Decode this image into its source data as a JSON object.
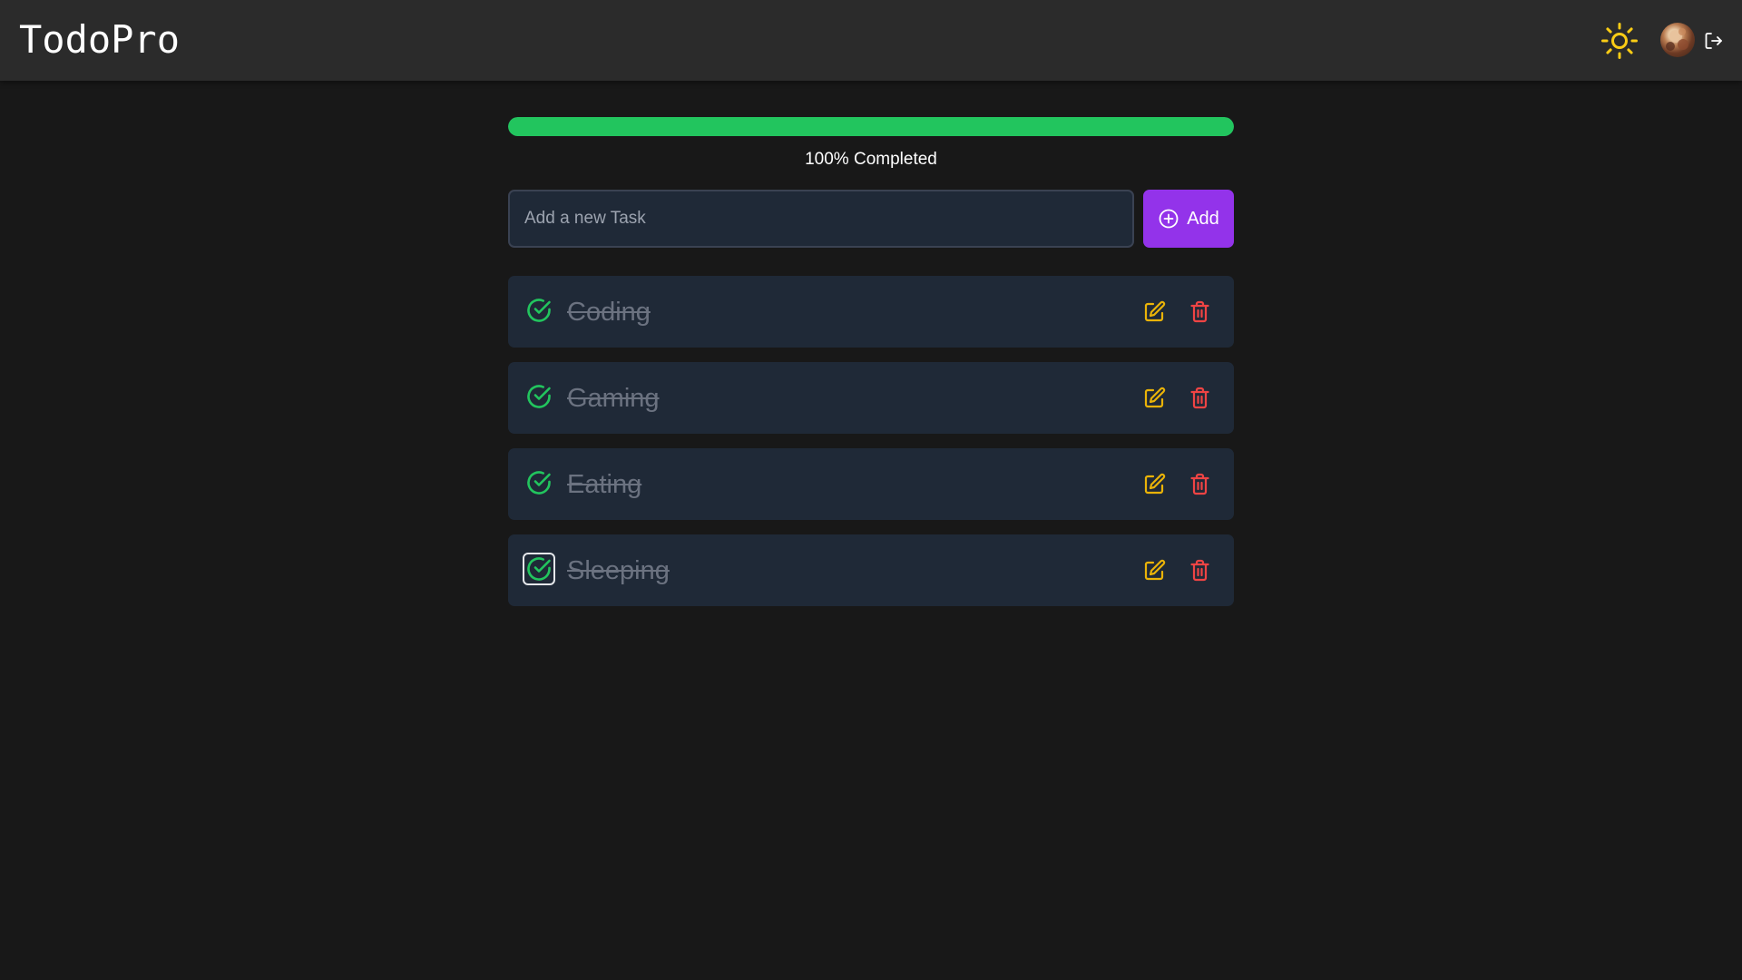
{
  "app": {
    "title": "TodoPro"
  },
  "header": {
    "theme_icon": "sun-icon",
    "avatar_icon": "user-avatar",
    "logout_icon": "logout-icon"
  },
  "progress": {
    "percent": 100,
    "label": "100% Completed"
  },
  "new_task": {
    "placeholder": "Add a new Task",
    "value": "",
    "add_label": "Add",
    "add_icon": "plus-circle-icon"
  },
  "tasks": [
    {
      "label": "Coding",
      "completed": true
    },
    {
      "label": "Gaming",
      "completed": true
    },
    {
      "label": "Eating",
      "completed": true
    },
    {
      "label": "Sleeping",
      "completed": true
    }
  ],
  "colors": {
    "header_bg": "#2b2b2b",
    "page_bg": "#181818",
    "card_bg": "#1f2937",
    "progress": "#22c55e",
    "accent": "#9333ea",
    "check": "#22c55e",
    "edit": "#eab308",
    "delete": "#ef4444",
    "sun": "#facc15"
  }
}
